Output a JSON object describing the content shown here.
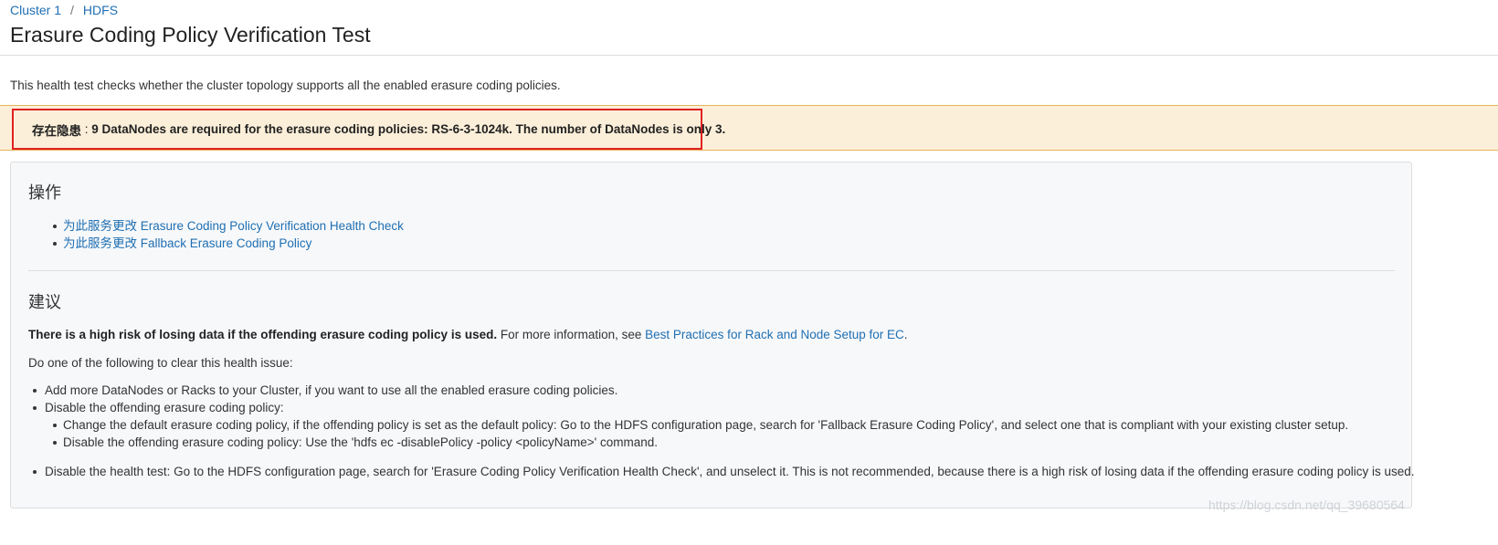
{
  "breadcrumb": {
    "items": [
      "Cluster 1",
      "HDFS"
    ],
    "separator": "/"
  },
  "page_title": "Erasure Coding Policy Verification Test",
  "description": "This health test checks whether the cluster topology supports all the enabled erasure coding policies.",
  "alert": {
    "label": "存在隐患",
    "separator": " : ",
    "message": "9 DataNodes are required for the erasure coding policies: RS-6-3-1024k. The number of DataNodes is only 3."
  },
  "actions": {
    "heading": "操作",
    "items": [
      "为此服务更改 Erasure Coding Policy Verification Health Check",
      "为此服务更改 Fallback Erasure Coding Policy"
    ]
  },
  "suggestions": {
    "heading": "建议",
    "risk_strong": "There is a high risk of losing data if the offending erasure coding policy is used.",
    "risk_text": " For more information, see ",
    "risk_link": "Best Practices for Rack and Node Setup for EC",
    "risk_end": ".",
    "intro": "Do one of the following to clear this health issue:",
    "items": [
      "Add more DataNodes or Racks to your Cluster, if you want to use all the enabled erasure coding policies.",
      "Disable the offending erasure coding policy:"
    ],
    "sub_items": [
      "Change the default erasure coding policy, if the offending policy is set as the default policy: Go to the HDFS configuration page, search for 'Fallback Erasure Coding Policy', and select one that is compliant with your existing cluster setup.",
      "Disable the offending erasure coding policy: Use the 'hdfs ec -disablePolicy -policy <policyName>' command."
    ],
    "last_item": "Disable the health test: Go to the HDFS configuration page, search for 'Erasure Coding Policy Verification Health Check', and unselect it. This is not recommended, because there is a high risk of losing data if the offending erasure coding policy is used."
  },
  "watermark": "https://blog.csdn.net/qq_39680564",
  "colors": {
    "link": "#1f6fb2",
    "alert_background": "#fcefd9",
    "alert_border": "#e8b458",
    "highlight_border": "#e02222"
  }
}
